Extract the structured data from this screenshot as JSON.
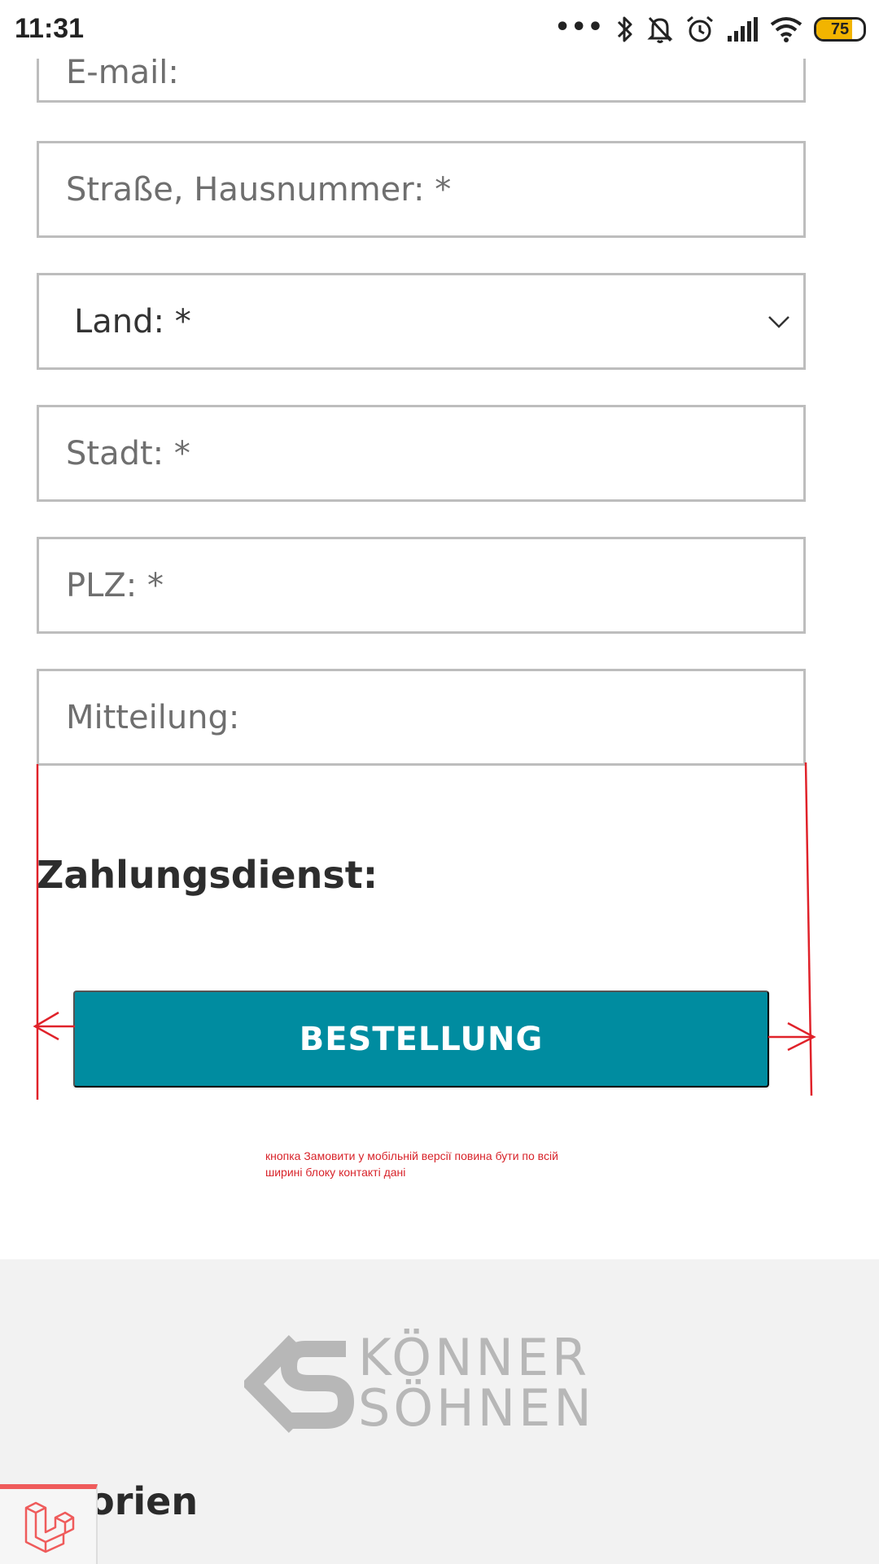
{
  "status_bar": {
    "time": "11:31",
    "dots": "•••",
    "battery": "75",
    "battery_level": 0.75,
    "icons": [
      "bluetooth-icon",
      "bell-muted-icon",
      "alarm-icon",
      "signal-icon",
      "wifi-icon",
      "battery-icon"
    ]
  },
  "form": {
    "email_placeholder": "E-mail:",
    "street_placeholder": "Straße, Hausnummer: *",
    "country_label": "Land: *",
    "city_placeholder": "Stadt: *",
    "zip_placeholder": "PLZ: *",
    "message_placeholder": "Mitteilung:"
  },
  "payment": {
    "heading": "Zahlungsdienst:"
  },
  "order_button": {
    "label": "BESTELLUNG",
    "color": "#008ca0"
  },
  "annotation": {
    "note": "кнопка Замовити у мобільній версії повина бути по всій ширині блоку контакті дані",
    "color": "#d8232a"
  },
  "footer": {
    "logo_line1": "KÖNNER",
    "logo_line2": "SÖHNEN",
    "categories_heading": "egorien"
  }
}
